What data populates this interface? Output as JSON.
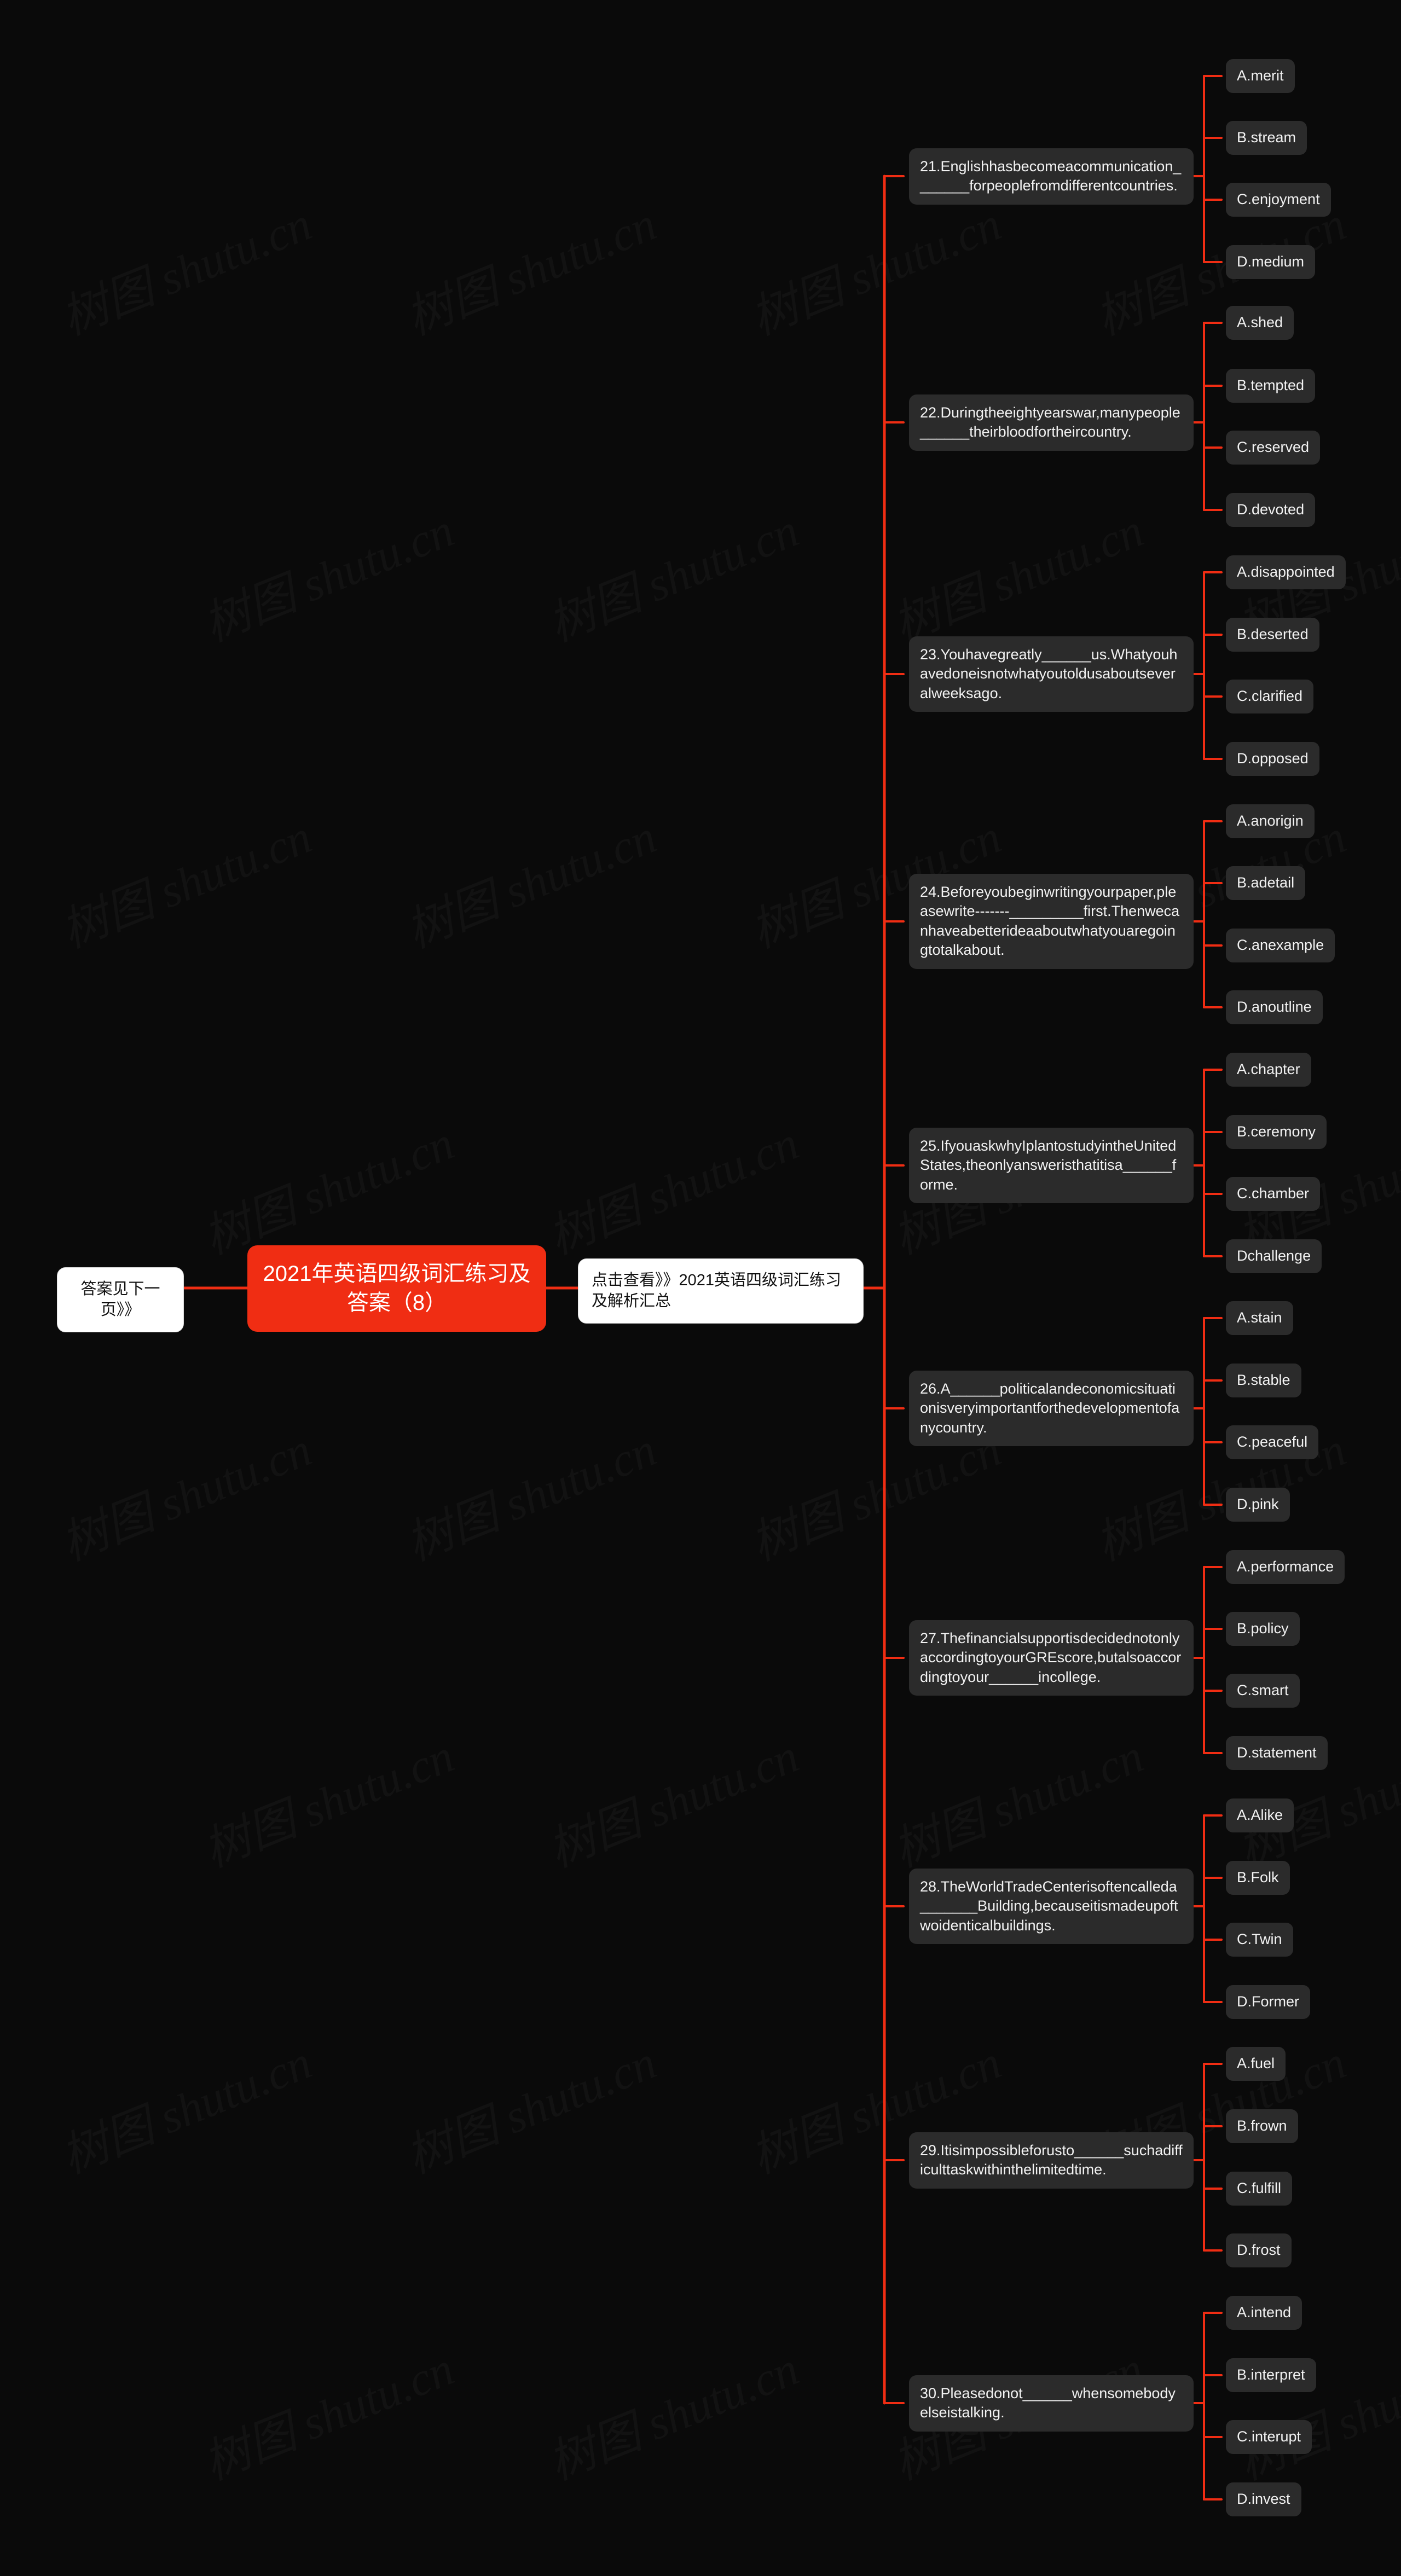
{
  "meta": {
    "background_color": "#0a0a0a",
    "accent_color": "#f02d13",
    "node_color": "#2b2b2b",
    "watermark_text_cn": "树图",
    "watermark_text_en": "shutu.cn"
  },
  "root": {
    "label": "2021年英语四级词汇练习及答案（8）"
  },
  "left_branch": {
    "label": "答案见下一页》》"
  },
  "top_branch": {
    "label": "点击查看》》2021英语四级词汇练习及解析汇总"
  },
  "questions": [
    {
      "id": "q21",
      "text": "21.Englishhasbecomeacommunication_______forpeoplefromdifferentcountries.",
      "options": [
        "A.merit",
        "B.stream",
        "C.enjoyment",
        "D.medium"
      ]
    },
    {
      "id": "q22",
      "text": "22.Duringtheeightyearswar,manypeople______theirbloodfortheircountry.",
      "options": [
        "A.shed",
        "B.tempted",
        "C.reserved",
        "D.devoted"
      ]
    },
    {
      "id": "q23",
      "text": "23.Youhavegreatly______us.Whatyouhavedoneisnotwhatyoutoldusaboutseveralweeksago.",
      "options": [
        "A.disappointed",
        "B.deserted",
        "C.clarified",
        "D.opposed"
      ]
    },
    {
      "id": "q24",
      "text": "24.Beforeyoubeginwritingyourpaper,pleasewrite-------_________first.Thenwecanhaveabetterideaaboutwhatyouaregoingtotalkabout.",
      "options": [
        "A.anorigin",
        "B.adetail",
        "C.anexample",
        "D.anoutline"
      ]
    },
    {
      "id": "q25",
      "text": "25.IfyouaskwhyIplantostudyintheUnitedStates,theonlyansweristhatitisa______forme.",
      "options": [
        "A.chapter",
        "B.ceremony",
        "C.chamber",
        "Dchallenge"
      ]
    },
    {
      "id": "q26",
      "text": "26.A______politicalandeconomicsituationisveryimportantforthedevelopmentofanycountry.",
      "options": [
        "A.stain",
        "B.stable",
        "C.peaceful",
        "D.pink"
      ]
    },
    {
      "id": "q27",
      "text": "27.ThefinancialsupportisdecidednotonlyaccordingtoyourGREscore,butalsoaccordingtoyour______incollege.",
      "options": [
        "A.performance",
        "B.policy",
        "C.smart",
        "D.statement"
      ]
    },
    {
      "id": "q28",
      "text": "28.TheWorldTradeCenterisoftencalleda_______Building,becauseitismadeupoftwoidenticalbuildings.",
      "options": [
        "A.Alike",
        "B.Folk",
        "C.Twin",
        "D.Former"
      ]
    },
    {
      "id": "q29",
      "text": "29.Itisimpossibleforusto______suchadifficulttaskwithinthelimitedtime.",
      "options": [
        "A.fuel",
        "B.frown",
        "C.fulfill",
        "D.frost"
      ]
    },
    {
      "id": "q30",
      "text": "30.Pleasedonot______whensomebodyelseistalking.",
      "options": [
        "A.intend",
        "B.interpret",
        "C.interupt",
        "D.invest"
      ]
    }
  ]
}
